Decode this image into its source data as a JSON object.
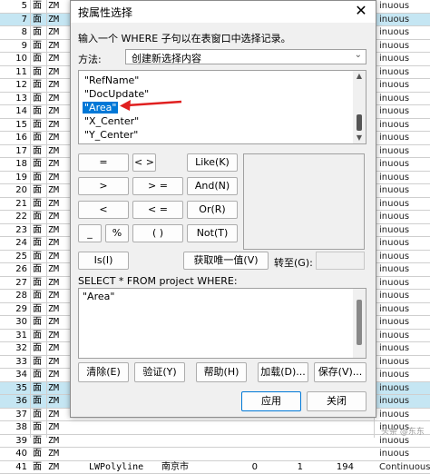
{
  "background_table": {
    "rows": [
      {
        "num": "5",
        "c1": "面",
        "c2": "ZM",
        "tail": "inuous",
        "hl": false
      },
      {
        "num": "7",
        "c1": "面",
        "c2": "ZM",
        "tail": "inuous",
        "hl": true
      },
      {
        "num": "8",
        "c1": "面",
        "c2": "ZM",
        "tail": "inuous",
        "hl": false
      },
      {
        "num": "9",
        "c1": "面",
        "c2": "ZM",
        "tail": "inuous",
        "hl": false
      },
      {
        "num": "10",
        "c1": "面",
        "c2": "ZM",
        "tail": "inuous",
        "hl": false
      },
      {
        "num": "11",
        "c1": "面",
        "c2": "ZM",
        "tail": "inuous",
        "hl": false
      },
      {
        "num": "12",
        "c1": "面",
        "c2": "ZM",
        "tail": "inuous",
        "hl": false
      },
      {
        "num": "13",
        "c1": "面",
        "c2": "ZM",
        "tail": "inuous",
        "hl": false
      },
      {
        "num": "14",
        "c1": "面",
        "c2": "ZM",
        "tail": "inuous",
        "hl": false
      },
      {
        "num": "15",
        "c1": "面",
        "c2": "ZM",
        "tail": "inuous",
        "hl": false
      },
      {
        "num": "16",
        "c1": "面",
        "c2": "ZM",
        "tail": "inuous",
        "hl": false
      },
      {
        "num": "17",
        "c1": "面",
        "c2": "ZM",
        "tail": "inuous",
        "hl": false
      },
      {
        "num": "18",
        "c1": "面",
        "c2": "ZM",
        "tail": "inuous",
        "hl": false
      },
      {
        "num": "19",
        "c1": "面",
        "c2": "ZM",
        "tail": "inuous",
        "hl": false
      },
      {
        "num": "20",
        "c1": "面",
        "c2": "ZM",
        "tail": "inuous",
        "hl": false
      },
      {
        "num": "21",
        "c1": "面",
        "c2": "ZM",
        "tail": "inuous",
        "hl": false
      },
      {
        "num": "22",
        "c1": "面",
        "c2": "ZM",
        "tail": "inuous",
        "hl": false
      },
      {
        "num": "23",
        "c1": "面",
        "c2": "ZM",
        "tail": "inuous",
        "hl": false
      },
      {
        "num": "24",
        "c1": "面",
        "c2": "ZM",
        "tail": "inuous",
        "hl": false
      },
      {
        "num": "25",
        "c1": "面",
        "c2": "ZM",
        "tail": "inuous",
        "hl": false
      },
      {
        "num": "26",
        "c1": "面",
        "c2": "ZM",
        "tail": "inuous",
        "hl": false
      },
      {
        "num": "27",
        "c1": "面",
        "c2": "ZM",
        "tail": "inuous",
        "hl": false
      },
      {
        "num": "28",
        "c1": "面",
        "c2": "ZM",
        "tail": "inuous",
        "hl": false
      },
      {
        "num": "29",
        "c1": "面",
        "c2": "ZM",
        "tail": "inuous",
        "hl": false
      },
      {
        "num": "30",
        "c1": "面",
        "c2": "ZM",
        "tail": "inuous",
        "hl": false
      },
      {
        "num": "31",
        "c1": "面",
        "c2": "ZM",
        "tail": "inuous",
        "hl": false
      },
      {
        "num": "32",
        "c1": "面",
        "c2": "ZM",
        "tail": "inuous",
        "hl": false
      },
      {
        "num": "33",
        "c1": "面",
        "c2": "ZM",
        "tail": "inuous",
        "hl": false
      },
      {
        "num": "34",
        "c1": "面",
        "c2": "ZM",
        "tail": "inuous",
        "hl": false
      },
      {
        "num": "35",
        "c1": "面",
        "c2": "ZM",
        "tail": "inuous",
        "hl": true
      },
      {
        "num": "36",
        "c1": "面",
        "c2": "ZM",
        "tail": "inuous",
        "hl": true
      },
      {
        "num": "37",
        "c1": "面",
        "c2": "ZM",
        "tail": "inuous",
        "hl": false
      },
      {
        "num": "38",
        "c1": "面",
        "c2": "ZM",
        "tail": "inuous",
        "hl": false
      },
      {
        "num": "39",
        "c1": "面",
        "c2": "ZM",
        "tail": "inuous",
        "hl": false
      },
      {
        "num": "40",
        "c1": "面",
        "c2": "ZM",
        "tail": "inuous",
        "hl": false
      },
      {
        "num": "41",
        "c1": "面",
        "c2": "ZM",
        "tail": "Continuous",
        "hl": false
      }
    ],
    "last_row": {
      "type": "LWPolyline",
      "city": "南京市",
      "v1": "0",
      "v2": "1",
      "v3": "194"
    },
    "watermark": "头条 @东东"
  },
  "dialog": {
    "title": "按属性选择",
    "close": "✕",
    "instruction": "输入一个 WHERE 子句以在表窗口中选择记录。",
    "method_label": "方法:",
    "method_value": "创建新选择内容",
    "fields": [
      "\"RefName\"",
      "\"DocUpdate\"",
      "\"Area\"",
      "\"X_Center\"",
      "\"Y_Center\""
    ],
    "selected_field_index": 2,
    "operators": {
      "eq": "=",
      "ne": "< >",
      "like": "Like(K)",
      "gt": ">",
      "ge": "> =",
      "and": "And(N)",
      "lt": "<",
      "le": "< =",
      "or": "Or(R)",
      "us": "_",
      "pct": "%",
      "paren": "( )",
      "not": "Not(T)",
      "is": "Is(I)"
    },
    "get_unique": "获取唯一值(V)",
    "goto_label": "转至(G):",
    "sql_label": "SELECT * FROM project WHERE:",
    "sql_text": "\"Area\"",
    "buttons": {
      "clear": "清除(E)",
      "verify": "验证(Y)",
      "help": "帮助(H)",
      "load": "加载(D)...",
      "save": "保存(V)...",
      "apply": "应用",
      "close": "关闭"
    }
  },
  "colors": {
    "selection": "#0078d7",
    "highlight_row": "#c5e6f3",
    "arrow": "#e02020",
    "dialog_bg": "#f0f0f0"
  }
}
